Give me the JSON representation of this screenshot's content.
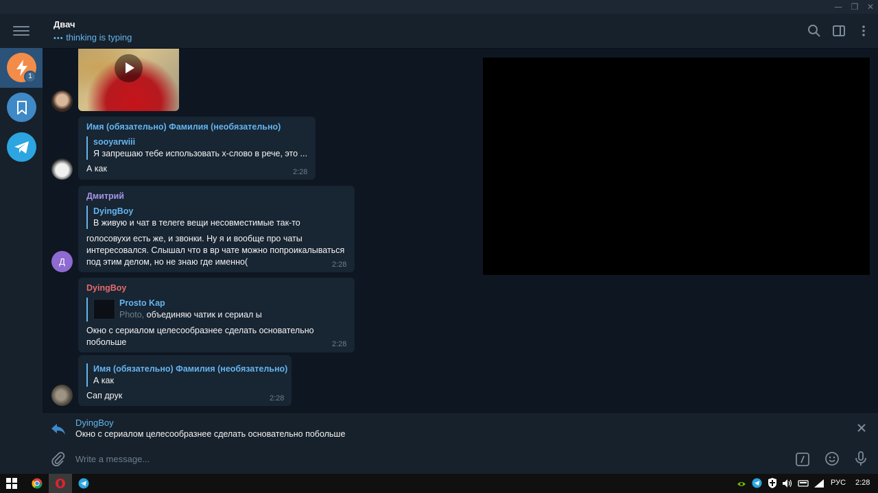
{
  "window": {
    "minimize": "—",
    "maximize": "❐",
    "close": "✕"
  },
  "header": {
    "title": "Двач",
    "status": "thinking is typing"
  },
  "folders": {
    "badge": "1"
  },
  "messages": [
    {
      "sender": "Имя (обязательно) Фамилия (необязательно)",
      "reply_name": "sooyarwiii",
      "reply_text": "Я запрешаю тебе использовать х-слово в рече, это ...",
      "text": "А как",
      "time": "2:28"
    },
    {
      "sender": "Дмитрий",
      "avatar_letter": "Д",
      "reply_name": "DyingBoy",
      "reply_text": "В живую и чат в телеге вещи несовместимые так-то",
      "text_lines": [
        "голосовухи есть же, и звонки. Ну я и вообще про чаты",
        "интересовался. Слышал что в вр чате можно попроикалываться",
        "под этим делом, но не знаю где именно("
      ],
      "time": "2:28"
    },
    {
      "sender": "DyingBoy",
      "reply_name": "Prosto Kap",
      "reply_prefix": "Photo,",
      "reply_text": " объединяю чатик и сериал ы",
      "text_lines": [
        "Окно с сериалом целесообразнее сделать основательно",
        "побольше"
      ],
      "time": "2:28"
    },
    {
      "reply_name": "Имя (обязательно) Фамилия (необязательно)",
      "reply_text": "А как",
      "text": "Сап друк",
      "time": "2:28"
    }
  ],
  "reply_bar": {
    "name": "DyingBoy",
    "text": "Окно с сериалом целесообразнее сделать основательно побольше"
  },
  "composer": {
    "placeholder": "Write a message...",
    "value": ""
  },
  "taskbar": {
    "language": "РУС",
    "clock": "2:28"
  },
  "colors": {
    "accent": "#64b5ef",
    "dmitry": "#a695e7",
    "dyingboy": "#e56a6a",
    "bubble": "#182533",
    "background": "#0e1621"
  }
}
